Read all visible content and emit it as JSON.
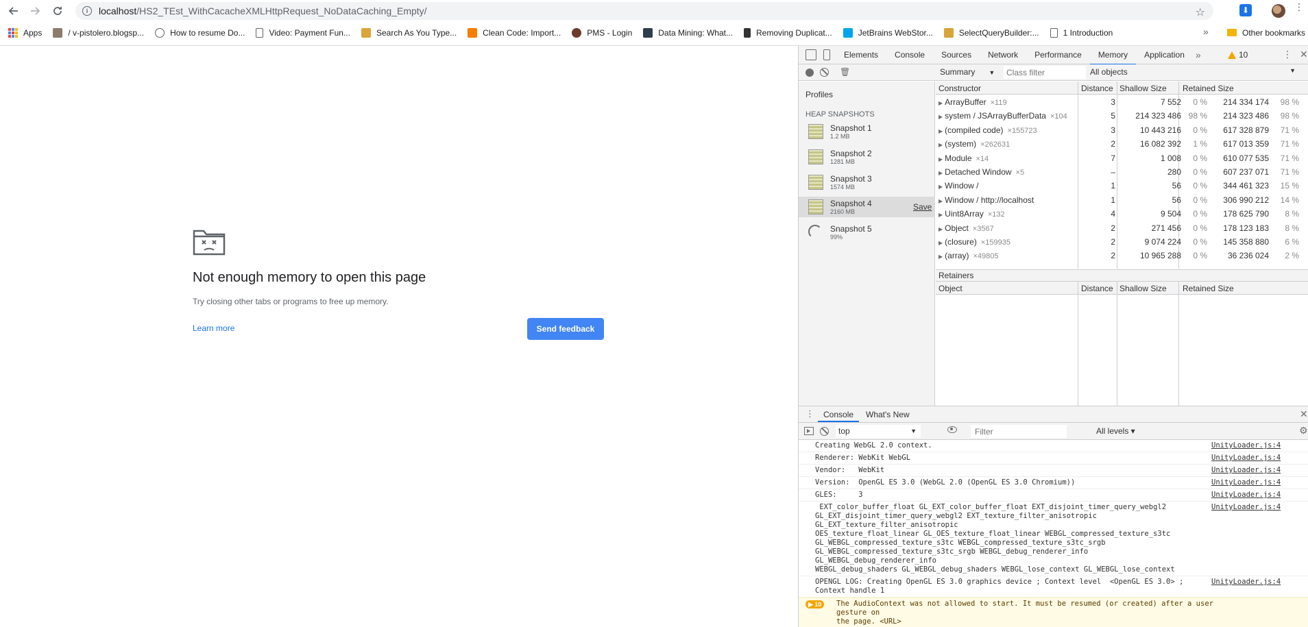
{
  "browser": {
    "url_host": "localhost",
    "url_path": "/HS2_TEst_WithCacacheXMLHttpRequest_NoDataCaching_Empty/",
    "bookmarks": [
      {
        "label": "Apps",
        "icon": "apps-grid-icon"
      },
      {
        "label": "/ v-pistolero.blogsp...",
        "icon": "blog-icon"
      },
      {
        "label": "How to resume Do...",
        "icon": "wordpress-icon"
      },
      {
        "label": "Video: Payment Fun...",
        "icon": "page-icon"
      },
      {
        "label": "Search As You Type...",
        "icon": "search-type-icon"
      },
      {
        "label": "Clean Code: Import...",
        "icon": "blogger-icon"
      },
      {
        "label": "PMS - Login",
        "icon": "pms-icon"
      },
      {
        "label": "Data Mining: What...",
        "icon": "vs-icon"
      },
      {
        "label": "Removing Duplicat...",
        "icon": "removing-icon"
      },
      {
        "label": "JetBrains WebStor...",
        "icon": "windows-icon"
      },
      {
        "label": "SelectQueryBuilder:...",
        "icon": "query-icon"
      },
      {
        "label": "1 Introduction",
        "icon": "page-icon"
      }
    ],
    "more_bookmarks": "»",
    "other_bookmarks": "Other bookmarks"
  },
  "error_page": {
    "title": "Not enough memory to open this page",
    "description": "Try closing other tabs or programs to free up memory.",
    "learn_more": "Learn more",
    "send_feedback": "Send feedback"
  },
  "devtools": {
    "tabs": [
      "Elements",
      "Console",
      "Sources",
      "Network",
      "Performance",
      "Memory",
      "Application"
    ],
    "active_tab": "Memory",
    "more_tabs": "»",
    "warning_count": "10",
    "memory": {
      "view_select": "Summary",
      "class_filter_placeholder": "Class filter",
      "objects_select": "All objects",
      "profiles_label": "Profiles",
      "heap_snapshots_label": "HEAP SNAPSHOTS",
      "snapshots": [
        {
          "name": "Snapshot 1",
          "size": "1.2 MB"
        },
        {
          "name": "Snapshot 2",
          "size": "1281 MB"
        },
        {
          "name": "Snapshot 3",
          "size": "1574 MB"
        },
        {
          "name": "Snapshot 4",
          "size": "2160 MB",
          "selected": true,
          "save": "Save"
        },
        {
          "name": "Snapshot 5",
          "size": "99%",
          "loading": true
        }
      ],
      "table_headers": {
        "constructor": "Constructor",
        "distance": "Distance",
        "shallow": "Shallow Size",
        "retained": "Retained Size"
      },
      "rows": [
        {
          "name": "ArrayBuffer",
          "count": "×119",
          "distance": "3",
          "shallow": "7 552",
          "shallow_pct": "0 %",
          "retained": "214 334 174",
          "retained_pct": "98 %"
        },
        {
          "name": "system / JSArrayBufferData",
          "count": "×104",
          "distance": "5",
          "shallow": "214 323 486",
          "shallow_pct": "98 %",
          "retained": "214 323 486",
          "retained_pct": "98 %"
        },
        {
          "name": "(compiled code)",
          "count": "×155723",
          "distance": "3",
          "shallow": "10 443 216",
          "shallow_pct": "0 %",
          "retained": "617 328 879",
          "retained_pct": "71 %"
        },
        {
          "name": "(system)",
          "count": "×262631",
          "distance": "2",
          "shallow": "16 082 392",
          "shallow_pct": "1 %",
          "retained": "617 013 359",
          "retained_pct": "71 %"
        },
        {
          "name": "Module",
          "count": "×14",
          "distance": "7",
          "shallow": "1 008",
          "shallow_pct": "0 %",
          "retained": "610 077 535",
          "retained_pct": "71 %"
        },
        {
          "name": "Detached Window",
          "count": "×5",
          "distance": "–",
          "shallow": "280",
          "shallow_pct": "0 %",
          "retained": "607 237 071",
          "retained_pct": "71 %"
        },
        {
          "name": "Window /",
          "count": "",
          "distance": "1",
          "shallow": "56",
          "shallow_pct": "0 %",
          "retained": "344 461 323",
          "retained_pct": "15 %"
        },
        {
          "name": "Window / http://localhost",
          "count": "",
          "distance": "1",
          "shallow": "56",
          "shallow_pct": "0 %",
          "retained": "306 990 212",
          "retained_pct": "14 %"
        },
        {
          "name": "Uint8Array",
          "count": "×132",
          "distance": "4",
          "shallow": "9 504",
          "shallow_pct": "0 %",
          "retained": "178 625 790",
          "retained_pct": "8 %"
        },
        {
          "name": "Object",
          "count": "×3567",
          "distance": "2",
          "shallow": "271 456",
          "shallow_pct": "0 %",
          "retained": "178 123 183",
          "retained_pct": "8 %"
        },
        {
          "name": "(closure)",
          "count": "×159935",
          "distance": "2",
          "shallow": "9 074 224",
          "shallow_pct": "0 %",
          "retained": "145 358 880",
          "retained_pct": "6 %"
        },
        {
          "name": "(array)",
          "count": "×49805",
          "distance": "2",
          "shallow": "10 965 288",
          "shallow_pct": "0 %",
          "retained": "36 236 024",
          "retained_pct": "2 %"
        }
      ],
      "retainers_label": "Retainers",
      "retainers_headers": {
        "object": "Object",
        "distance": "Distance",
        "shallow": "Shallow Size",
        "retained": "Retained Size"
      }
    },
    "drawer": {
      "tabs": [
        "Console",
        "What's New"
      ],
      "context": "top",
      "filter_placeholder": "Filter",
      "levels": "All levels ▾",
      "logs": [
        {
          "msg": "Creating WebGL 2.0 context.",
          "src": "UnityLoader.js:4"
        },
        {
          "msg": "Renderer: WebKit WebGL",
          "src": "UnityLoader.js:4"
        },
        {
          "msg": "Vendor:   WebKit",
          "src": "UnityLoader.js:4"
        },
        {
          "msg": "Version:  OpenGL ES 3.0 (WebGL 2.0 (OpenGL ES 3.0 Chromium))",
          "src": "UnityLoader.js:4"
        },
        {
          "msg": "GLES:     3",
          "src": "UnityLoader.js:4"
        },
        {
          "msg": " EXT_color_buffer_float GL_EXT_color_buffer_float EXT_disjoint_timer_query_webgl2\nGL_EXT_disjoint_timer_query_webgl2 EXT_texture_filter_anisotropic GL_EXT_texture_filter_anisotropic\nOES_texture_float_linear GL_OES_texture_float_linear WEBGL_compressed_texture_s3tc\nGL_WEBGL_compressed_texture_s3tc WEBGL_compressed_texture_s3tc_srgb\nGL_WEBGL_compressed_texture_s3tc_srgb WEBGL_debug_renderer_info GL_WEBGL_debug_renderer_info\nWEBGL_debug_shaders GL_WEBGL_debug_shaders WEBGL_lose_context GL_WEBGL_lose_context",
          "src": "UnityLoader.js:4"
        },
        {
          "msg": "OPENGL LOG: Creating OpenGL ES 3.0 graphics device ; Context level  <OpenGL ES 3.0> ;\nContext handle 1",
          "src": "UnityLoader.js:4"
        }
      ],
      "warning": {
        "badge": "10",
        "msg": "The AudioContext was not allowed to start. It must be resumed (or created) after a user gesture on\nthe page. <URL>"
      }
    }
  },
  "colors": {
    "accent": "#1a73e8",
    "feedback_button": "#4285f4",
    "warning": "#f2a600"
  }
}
